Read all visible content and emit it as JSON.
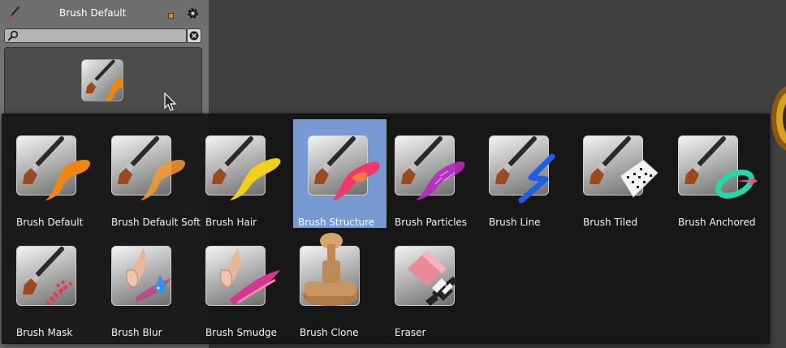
{
  "panel": {
    "title": "Brush Default",
    "icons": [
      "brush-icon",
      "dot-icon",
      "gear-icon",
      "search-icon",
      "close-icon"
    ]
  },
  "popup": {
    "tiles": [
      {
        "label": "Brush Default",
        "icon": "brush-default-icon"
      },
      {
        "label": "Brush Default Soft",
        "icon": "brush-default-soft-icon"
      },
      {
        "label": "Brush Hair",
        "icon": "brush-hair-icon"
      },
      {
        "label": "Brush Structure",
        "icon": "brush-structure-icon",
        "selected": true
      },
      {
        "label": "Brush Particles",
        "icon": "brush-particles-icon"
      },
      {
        "label": "Brush Line",
        "icon": "brush-line-icon"
      },
      {
        "label": "Brush Tiled",
        "icon": "brush-tiled-icon"
      },
      {
        "label": "Brush Anchored",
        "icon": "brush-anchored-icon"
      },
      {
        "label": "Brush Mask",
        "icon": "brush-mask-icon"
      },
      {
        "label": "Brush Blur",
        "icon": "brush-blur-icon"
      },
      {
        "label": "Brush Smudge",
        "icon": "brush-smudge-icon"
      },
      {
        "label": "Brush Clone",
        "icon": "brush-clone-icon"
      },
      {
        "label": "Eraser",
        "icon": "eraser-icon"
      }
    ]
  },
  "colors": {
    "selection": "#7899d1",
    "popup_bg": "#141414",
    "panel_bg": "#727272",
    "viewport_bg": "#404040"
  }
}
